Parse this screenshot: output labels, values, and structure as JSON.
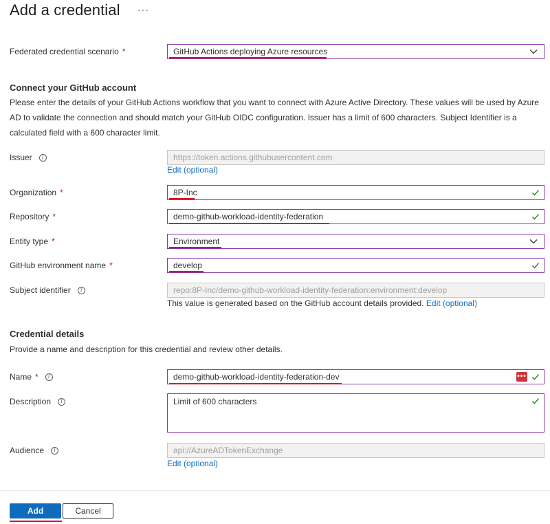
{
  "header": {
    "title": "Add a credential",
    "more_label": "···"
  },
  "scenario": {
    "label": "Federated credential scenario",
    "required": "*",
    "value": "GitHub Actions deploying Azure resources"
  },
  "connect": {
    "heading": "Connect your GitHub account",
    "description": "Please enter the details of your GitHub Actions workflow that you want to connect with Azure Active Directory. These values will be used by Azure AD to validate the connection and should match your GitHub OIDC configuration. Issuer has a limit of 600 characters. Subject Identifier is a calculated field with a 600 character limit."
  },
  "issuer": {
    "label": "Issuer",
    "value": "https://token.actions.githubusercontent.com",
    "edit_link": "Edit (optional)"
  },
  "organization": {
    "label": "Organization",
    "required": "*",
    "value": "8P-Inc"
  },
  "repository": {
    "label": "Repository",
    "required": "*",
    "value": "demo-github-workload-identity-federation"
  },
  "entity_type": {
    "label": "Entity type",
    "required": "*",
    "value": "Environment"
  },
  "environment": {
    "label": "GitHub environment name",
    "required": "*",
    "value": "develop"
  },
  "subject": {
    "label": "Subject identifier",
    "value": "repo:8P-Inc/demo-github-workload-identity-federation:environment:develop",
    "note": "This value is generated based on the GitHub account details provided.",
    "edit_link": "Edit (optional)"
  },
  "details": {
    "heading": "Credential details",
    "description": "Provide a name and description for this credential and review other details."
  },
  "name": {
    "label": "Name",
    "required": "*",
    "value": "demo-github-workload-identity-federation-dev",
    "password_icon": "•••"
  },
  "description_field": {
    "label": "Description",
    "placeholder": "Limit of 600 characters"
  },
  "audience": {
    "label": "Audience",
    "value": "api://AzureADTokenExchange",
    "edit_link": "Edit (optional)"
  },
  "footer": {
    "add_label": "Add",
    "cancel_label": "Cancel"
  },
  "colors": {
    "accent": "#0f6cbd",
    "field_border": "#8b3ba8",
    "required": "#a4262c",
    "valid": "#107c10",
    "annotation": "#e0102a"
  },
  "icons": {
    "info": "info-icon",
    "chevron": "chevron-down-icon",
    "check": "checkmark-icon",
    "password": "password-manager-icon"
  }
}
